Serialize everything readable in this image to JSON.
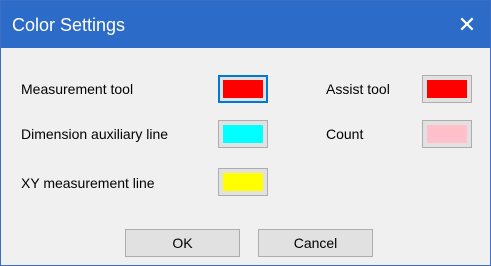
{
  "window": {
    "title": "Color Settings",
    "close_glyph": "✕"
  },
  "settings": [
    {
      "label": "Measurement tool",
      "color": "#ff0000",
      "focused": true
    },
    {
      "label": "Dimension auxiliary line",
      "color": "#00ffff",
      "focused": false
    },
    {
      "label": "XY measurement line",
      "color": "#ffff00",
      "focused": false
    },
    {
      "label": "Assist tool",
      "color": "#ff0000",
      "focused": false
    },
    {
      "label": "Count",
      "color": "#ffc0cb",
      "focused": false
    }
  ],
  "buttons": {
    "ok_label": "OK",
    "cancel_label": "Cancel"
  },
  "theme": {
    "titlebar_color": "#2d6bc9",
    "focus_color": "#0078d7"
  }
}
